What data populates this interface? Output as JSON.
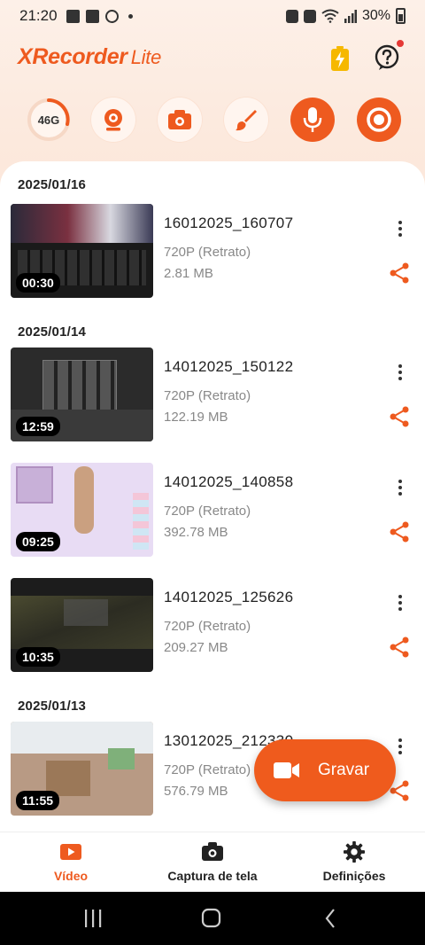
{
  "status_bar": {
    "time": "21:20",
    "battery_percent": "30%"
  },
  "header": {
    "logo_main": "XRecorder",
    "logo_sub": "Lite"
  },
  "actions": {
    "storage_label": "46G"
  },
  "groups": [
    {
      "date": "2025/01/16"
    },
    {
      "date": "2025/01/14"
    },
    {
      "date": "2025/01/13"
    }
  ],
  "videos": [
    {
      "title": "16012025_160707",
      "resolution": "720P (Retrato)",
      "size": "2.81 MB",
      "duration": "00:30"
    },
    {
      "title": "14012025_150122",
      "resolution": "720P (Retrato)",
      "size": "122.19 MB",
      "duration": "12:59"
    },
    {
      "title": "14012025_140858",
      "resolution": "720P (Retrato)",
      "size": "392.78 MB",
      "duration": "09:25"
    },
    {
      "title": "14012025_125626",
      "resolution": "720P (Retrato)",
      "size": "209.27 MB",
      "duration": "10:35"
    },
    {
      "title": "13012025_212330",
      "resolution": "720P (Retrato)",
      "size": "576.79 MB",
      "duration": "11:55"
    }
  ],
  "fab": {
    "label": "Gravar"
  },
  "bottom_nav": {
    "tabs": [
      {
        "label": "Vídeo",
        "icon": "play-icon",
        "active": true
      },
      {
        "label": "Captura de tela",
        "icon": "camera-icon",
        "active": false
      },
      {
        "label": "Definições",
        "icon": "gear-icon",
        "active": false
      }
    ]
  },
  "colors": {
    "accent": "#EE5A1F",
    "text": "#222222",
    "muted": "#888888"
  }
}
